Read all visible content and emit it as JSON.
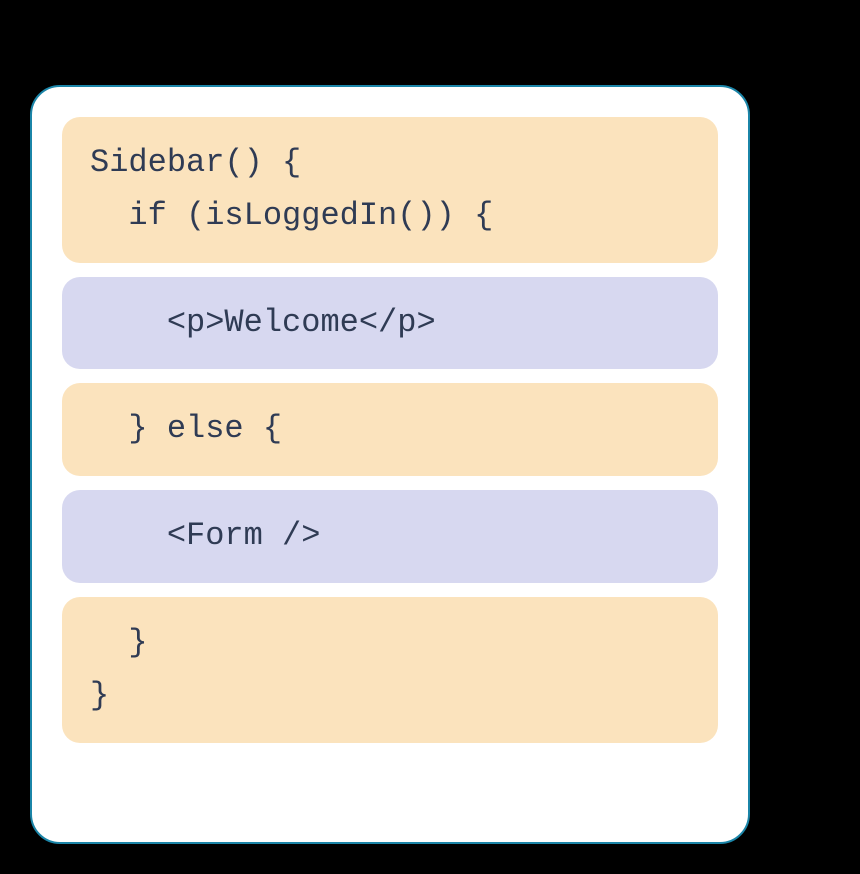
{
  "code": {
    "blocks": [
      {
        "style": "orange",
        "text": "Sidebar() {\n  if (isLoggedIn()) {"
      },
      {
        "style": "purple",
        "text": "    <p>Welcome</p>"
      },
      {
        "style": "orange",
        "text": "  } else {"
      },
      {
        "style": "purple",
        "text": "    <Form />"
      },
      {
        "style": "orange",
        "text": "  }\n}"
      }
    ]
  }
}
